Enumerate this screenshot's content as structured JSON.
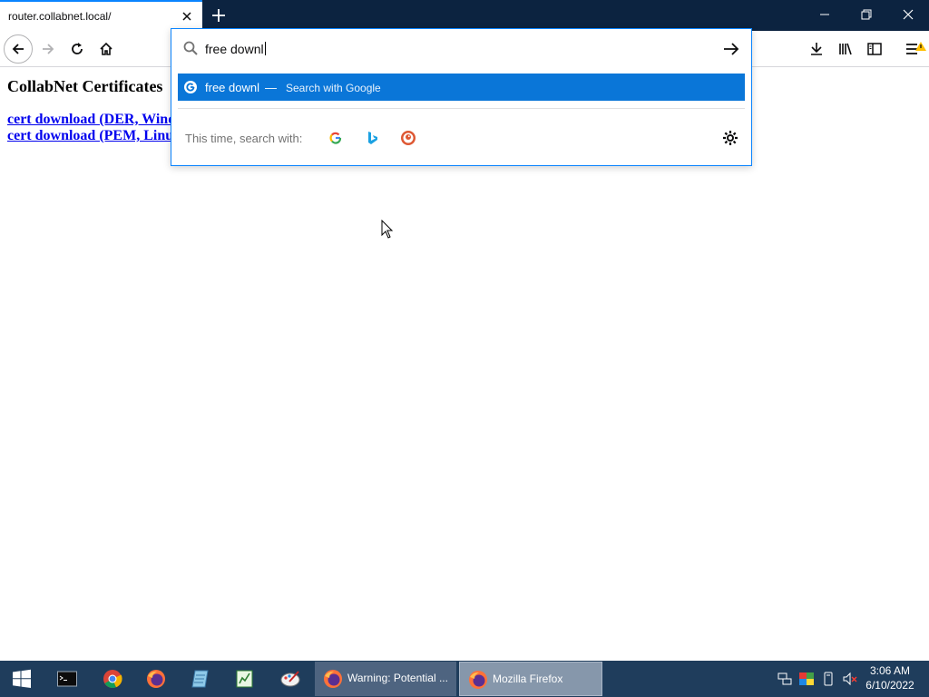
{
  "tab": {
    "title": "router.collabnet.local/"
  },
  "page": {
    "heading": "CollabNet Certificates",
    "links": [
      "cert download (DER, Wind",
      "cert download (PEM, Linu"
    ]
  },
  "urlbar": {
    "query": "free downl",
    "suggestion": {
      "text": "free downl",
      "separator": "—",
      "action": "Search with Google"
    },
    "one_off_label": "This time, search with:",
    "engines": [
      "google-icon",
      "bing-icon",
      "duckduckgo-icon"
    ]
  },
  "taskbar": {
    "apps": [
      {
        "label": "Warning: Potential ...",
        "active": false
      },
      {
        "label": "Mozilla Firefox",
        "active": true
      }
    ],
    "time": "3:06 AM",
    "date": "6/10/2022"
  },
  "colors": {
    "accent": "#0a84ff",
    "suggestion_bg": "#0a76d8",
    "taskbar": "#1f3d5c",
    "titlebar": "#0c2340"
  }
}
